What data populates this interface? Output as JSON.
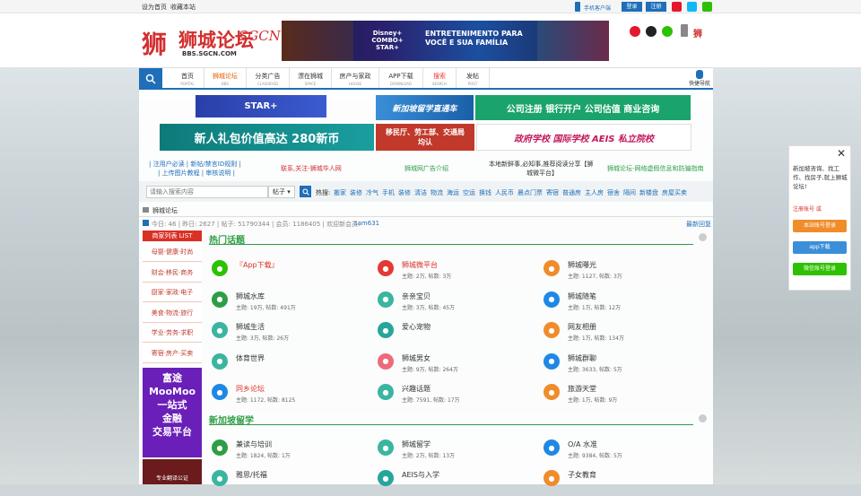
{
  "topbar": {
    "set_home": "设为首页",
    "bookmark": "收藏本站",
    "mobile": "手机客户端",
    "login": "登录",
    "register": "注册"
  },
  "logo": {
    "text": "狮城论坛",
    "en": "BBS.SGCN.COM",
    "script": "SGCN"
  },
  "ads": {
    "top_banner": "ENTRETENIMENTO PARA VOCÊ E SUA FAMÍLIA",
    "disney": "Disney+ COMBO+ STAR+",
    "b1": "STAR+",
    "b2": "新加坡留学直通车",
    "b3": "公司注册  银行开户  公司估值  商业咨询",
    "b4": "新人礼包价值高达 280新币",
    "b5": "移民厅、劳工部、交通局均认",
    "b6": "政府学校  国际学校  AEIS 私立院校",
    "moomoo": [
      "富途",
      "MooMoo",
      "一站式",
      "金融",
      "交易平台"
    ],
    "translate": "专业翻译公证"
  },
  "nav": [
    {
      "label": "首页",
      "en": "PORTAL"
    },
    {
      "label": "狮城论坛",
      "en": "BBS"
    },
    {
      "label": "分类广告",
      "en": "CLASSIFIED"
    },
    {
      "label": "漂在狮城",
      "en": "SPACE"
    },
    {
      "label": "房产与家政",
      "en": "HOUSE"
    },
    {
      "label": "APP下载",
      "en": "DOWNLOAD"
    },
    {
      "label": "搜索",
      "en": "SEARCH"
    },
    {
      "label": "发帖",
      "en": "POST"
    }
  ],
  "quick_nav": "快捷导航",
  "links": {
    "l1": "| 注用户必读 | 新帖/禁言ID规则 |",
    "l2": "| 上传图片教程 | 审核说明 |",
    "l3": "联系,关注-狮城华人网",
    "l4": "狮城网广告介绍",
    "l5": "本地新鲜事,必知事,推荐阅读分享【狮",
    "l6": "城微平台】",
    "l7": "狮城论坛-网络虚假信息和防骗指南"
  },
  "search": {
    "placeholder": "请输入搜索内容",
    "type": "帖子",
    "hot_label": "热搜:",
    "hot": [
      "搬家",
      "装修",
      "冷气",
      "手机",
      "装修",
      "清洁",
      "物流",
      "海运",
      "空运",
      "换钱",
      "人民币",
      "晨点门票",
      "寄宿",
      "普通房",
      "主人房",
      "宿舍",
      "隔间",
      "新楼盘",
      "房屋买卖"
    ]
  },
  "breadcrumb": "狮城论坛",
  "stats": {
    "text": "今日: 46 | 昨日: 2627 | 帖子: 51790344 | 会员: 1186405 | 欢迎新会员:",
    "new_member": "sam631",
    "latest": "最新回复"
  },
  "sidebar": {
    "title": "商家列表 LIST",
    "items": [
      "母婴·健康·时尚",
      "财会·移民·商务",
      "厨家·家政·电子",
      "美食·物流·旅行",
      "学业·劳务·求职",
      "寄宿·房产·买卖"
    ]
  },
  "sections": [
    {
      "title": "热门话题",
      "forums": [
        {
          "name": "『App下载』",
          "stat": "",
          "hl": true
        },
        {
          "name": "狮城微平台",
          "stat": "主题: 2万, 帖数: 3万",
          "hl": true
        },
        {
          "name": "狮城曝光",
          "stat": "主题: 1127, 帖数: 3万",
          "hl": false
        },
        {
          "name": "狮城水库",
          "stat": "主题: 19万, 帖数: 491万",
          "hl": false
        },
        {
          "name": "亲亲宝贝",
          "stat": "主题: 3万, 帖数: 45万",
          "hl": false
        },
        {
          "name": "狮城随笔",
          "stat": "主题: 1万, 帖数: 12万",
          "hl": false
        },
        {
          "name": "狮城生活",
          "stat": "主题: 3万, 帖数: 26万",
          "hl": false
        },
        {
          "name": "爱心宠物",
          "stat": "",
          "hl": false
        },
        {
          "name": "网友相册",
          "stat": "主题: 1万, 帖数: 134万",
          "hl": false
        },
        {
          "name": "体育世界",
          "stat": "",
          "hl": false
        },
        {
          "name": "狮城男女",
          "stat": "主题: 9万, 帖数: 264万",
          "hl": false
        },
        {
          "name": "狮城群聊",
          "stat": "主题: 3633, 帖数: 5万",
          "hl": false
        },
        {
          "name": "同乡论坛",
          "stat": "主题: 1172, 帖数: 8125",
          "hl": true
        },
        {
          "name": "兴趣话题",
          "stat": "主题: 7591, 帖数: 17万",
          "hl": false
        },
        {
          "name": "旅游天堂",
          "stat": "主题: 1万, 帖数: 9万",
          "hl": false
        }
      ]
    },
    {
      "title": "新加坡留学",
      "forums": [
        {
          "name": "兼读与培训",
          "stat": "主题: 1824, 帖数: 1万",
          "hl": false
        },
        {
          "name": "狮城留学",
          "stat": "主题: 2万, 帖数: 13万",
          "hl": false
        },
        {
          "name": "O/A 水准",
          "stat": "主题: 9384, 帖数: 5万",
          "hl": false
        },
        {
          "name": "雅思/托福",
          "stat": "",
          "hl": false
        },
        {
          "name": "AEIS与入学",
          "stat": "",
          "hl": false
        },
        {
          "name": "子女教育",
          "stat": "",
          "hl": false
        }
      ]
    }
  ],
  "float": {
    "text": "新加坡咨询、找工作、找房子,就上狮城论坛!",
    "register": "注册账号 或",
    "btn_login": "本站账号登录",
    "btn_app": "app下载",
    "btn_wechat": "微信账号登录"
  },
  "colors": {
    "nav_blue": "#1e6fb8",
    "green": "#2e9e45",
    "red": "#c0392b",
    "orange": "#f08c2a"
  }
}
